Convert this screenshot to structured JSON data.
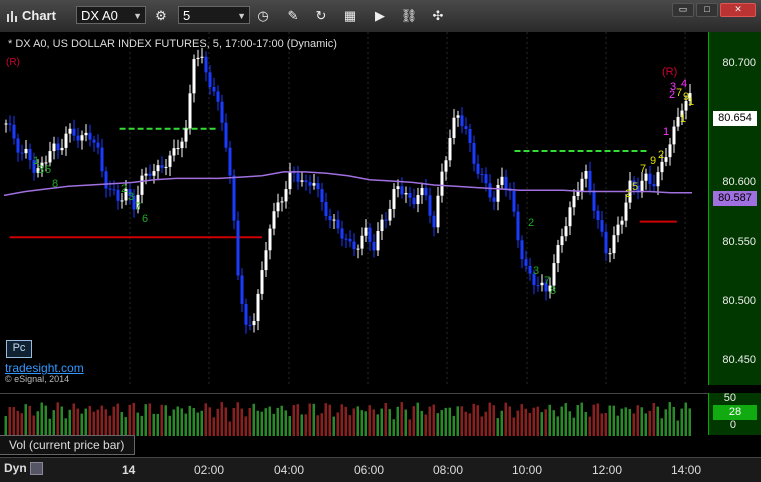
{
  "toolbar": {
    "app_label": "Chart",
    "symbol": "DX A0",
    "interval": "5",
    "buttons": [
      "cursor-icon",
      "settings-icon",
      "clock-icon",
      "pencil-icon",
      "refresh-icon",
      "gap-icon",
      "play-icon",
      "link-icon",
      "tool-icon"
    ]
  },
  "chart": {
    "title": "* DX A0, US DOLLAR INDEX FUTURES, 5, 17:00-17:00 (Dynamic)",
    "r_tag": "(R)",
    "r_tag_right": "(R)",
    "pc_label": "Pc",
    "watermark": "tradesight.com",
    "copyright": "© eSignal, 2014",
    "last_price": "80.654",
    "ma_price": "80.587",
    "colors": {
      "up_bar": "#ffffff",
      "down_bar": "#1a3cff",
      "ma_line": "#a070e0",
      "resistance": "#cc0000",
      "green_level": "#33dd33",
      "axis_bg": "#003800",
      "seq_green": "#22aa22",
      "seq_yellow": "#e0e000",
      "seq_magenta": "#ff33ff"
    }
  },
  "volume": {
    "label": "Vol (current price bar)",
    "current": "28",
    "ticks": [
      "50",
      "25",
      "0"
    ]
  },
  "xaxis": {
    "dyn_label": "Dyn",
    "ticks": [
      "14",
      "02:00",
      "04:00",
      "06:00",
      "08:00",
      "10:00",
      "12:00",
      "14:00"
    ]
  },
  "chart_data": {
    "type": "candlestick",
    "y_ticks": [
      "80.700",
      "80.650",
      "80.600",
      "80.550",
      "80.500",
      "80.450"
    ],
    "ylim": [
      80.44,
      80.71
    ],
    "x_ticks": [
      "14",
      "02:00",
      "04:00",
      "06:00",
      "08:00",
      "10:00",
      "12:00",
      "14:00"
    ],
    "series": [
      {
        "values": [
          80.64,
          80.628,
          80.612,
          80.618,
          80.602,
          80.614,
          80.622,
          80.618,
          80.628,
          80.632,
          80.629,
          80.636,
          80.626,
          80.596,
          80.584,
          80.58,
          80.588,
          80.58,
          80.598,
          80.604,
          80.6,
          80.606,
          80.614,
          80.628,
          80.636,
          80.694,
          80.686,
          80.671,
          80.656,
          80.64,
          80.59,
          80.52,
          80.478,
          80.49,
          80.52,
          80.562,
          80.578,
          80.59,
          80.602,
          80.596,
          80.588,
          80.598,
          80.58,
          80.572,
          80.56,
          80.552,
          80.54,
          80.548,
          80.56,
          80.548,
          80.566,
          80.572,
          80.59,
          80.586,
          80.578,
          80.594,
          80.584,
          80.56,
          80.6,
          80.624,
          80.65,
          80.64,
          80.62,
          80.6,
          80.59,
          80.576,
          80.6,
          80.59,
          80.56,
          80.53,
          80.52,
          80.512,
          80.51,
          80.535,
          80.56,
          80.574,
          80.59,
          80.6,
          80.58,
          80.56,
          80.542,
          80.556,
          80.57,
          80.59,
          80.588,
          80.598,
          80.596,
          80.606,
          80.622,
          80.634,
          80.652,
          80.658
        ]
      }
    ],
    "moving_average": [
      80.585,
      80.588,
      80.59,
      80.592,
      80.593,
      80.594,
      80.595,
      80.597,
      80.598,
      80.598,
      80.598,
      80.599,
      80.6,
      80.603,
      80.603,
      80.602,
      80.6,
      80.597,
      80.596,
      80.595,
      80.593,
      80.592,
      80.591,
      80.59,
      80.589,
      80.589,
      80.589,
      80.588,
      80.588,
      80.588,
      80.588,
      80.587,
      80.587
    ],
    "levels": [
      {
        "name": "green",
        "from": 0.168,
        "to": 0.308,
        "y": 80.636
      },
      {
        "name": "red",
        "from": 0.008,
        "to": 0.375,
        "y": 80.553
      },
      {
        "name": "green",
        "from": 0.742,
        "to": 0.934,
        "y": 80.619
      },
      {
        "name": "red",
        "from": 0.924,
        "to": 0.978,
        "y": 80.565
      }
    ]
  }
}
